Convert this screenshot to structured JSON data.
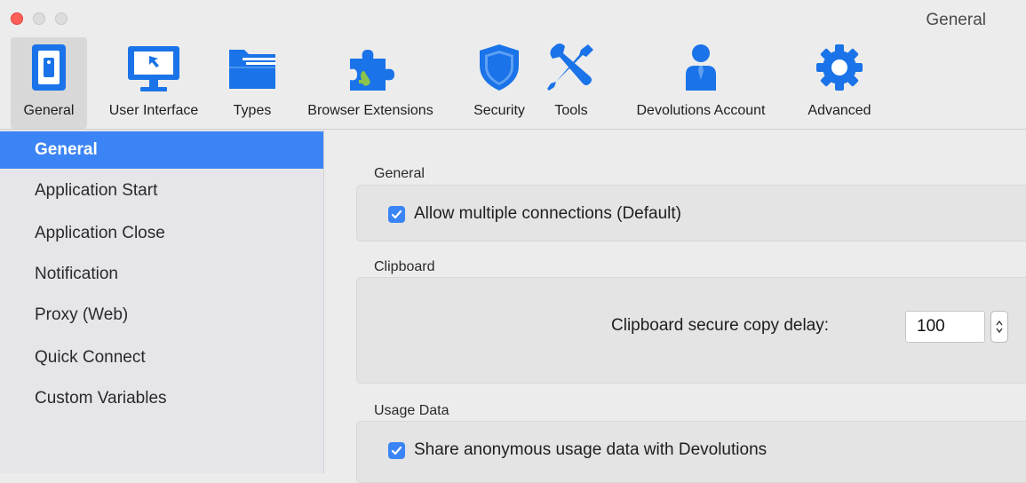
{
  "window": {
    "title": "General"
  },
  "toolbar": {
    "items": [
      {
        "label": "General",
        "icon": "switch-icon",
        "active": true
      },
      {
        "label": "User Interface",
        "icon": "monitor-icon"
      },
      {
        "label": "Types",
        "icon": "folder-icon"
      },
      {
        "label": "Browser Extensions",
        "icon": "puzzle-icon"
      },
      {
        "label": "Security",
        "icon": "shield-icon"
      },
      {
        "label": "Tools",
        "icon": "tools-icon"
      },
      {
        "label": "Devolutions Account",
        "icon": "user-icon"
      },
      {
        "label": "Advanced",
        "icon": "gear-icon"
      }
    ]
  },
  "sidebar": {
    "items": [
      {
        "label": "General",
        "selected": true
      },
      {
        "label": "Application Start"
      },
      {
        "label": "Application Close"
      },
      {
        "label": "Notification"
      },
      {
        "label": "Proxy (Web)"
      },
      {
        "label": "Quick Connect"
      },
      {
        "label": "Custom Variables"
      }
    ]
  },
  "main": {
    "general": {
      "label": "General",
      "allow_multiple": {
        "label": "Allow multiple connections (Default)",
        "checked": true
      }
    },
    "clipboard": {
      "label": "Clipboard",
      "delay_label": "Clipboard secure copy delay:",
      "delay_value": "100"
    },
    "usage": {
      "label": "Usage Data",
      "share": {
        "label": "Share anonymous usage data with Devolutions",
        "checked": true
      }
    }
  },
  "colors": {
    "accent": "#3b84f5",
    "icon_blue": "#1a73e8",
    "close_red": "#fe5f57"
  }
}
